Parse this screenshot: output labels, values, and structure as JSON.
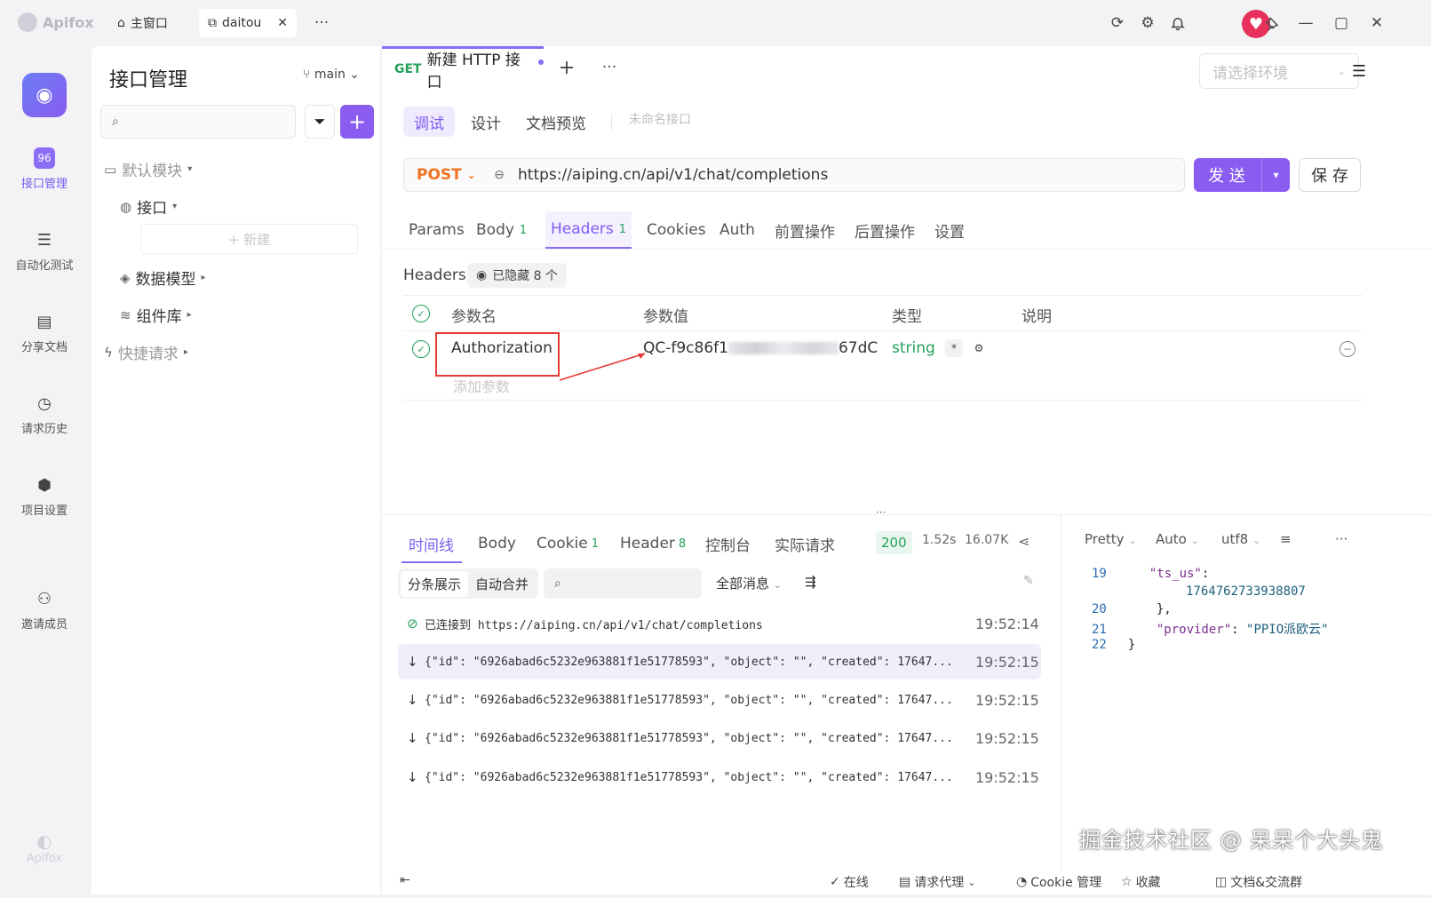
{
  "titlebar": {
    "app_name": "Apifox",
    "tabs": [
      {
        "label": "主窗口"
      },
      {
        "label": "daitou"
      }
    ],
    "more": "···"
  },
  "rail": {
    "items": [
      {
        "label": "接口管理",
        "icon": "api-icon"
      },
      {
        "label": "自动化测试",
        "icon": "stack-icon"
      },
      {
        "label": "分享文档",
        "icon": "book-icon"
      },
      {
        "label": "请求历史",
        "icon": "clock-icon"
      },
      {
        "label": "项目设置",
        "icon": "hexagon-icon"
      },
      {
        "label": "邀请成员",
        "icon": "user-plus-icon"
      }
    ],
    "footer": "Apifox"
  },
  "sidebar": {
    "title": "接口管理",
    "branch": "main",
    "tree": [
      {
        "label": "默认模块"
      },
      {
        "label": "接口"
      },
      {
        "label": "+ 新建"
      },
      {
        "label": "数据模型"
      },
      {
        "label": "组件库"
      },
      {
        "label": "快捷请求"
      }
    ]
  },
  "editor": {
    "doc_tab": {
      "method": "GET",
      "title": "新建 HTTP 接口"
    },
    "env_placeholder": "请选择环境",
    "sub_tabs": [
      {
        "label": "调试"
      },
      {
        "label": "设计"
      },
      {
        "label": "文档预览"
      }
    ],
    "unnamed": "未命名接口",
    "method": "POST",
    "url": "https://aiping.cn/api/v1/chat/completions",
    "send_label": "发 送",
    "save_label": "保 存",
    "req_tabs": [
      {
        "label": "Params",
        "count": ""
      },
      {
        "label": "Body",
        "count": "1"
      },
      {
        "label": "Headers",
        "count": "1"
      },
      {
        "label": "Cookies",
        "count": ""
      },
      {
        "label": "Auth",
        "count": ""
      },
      {
        "label": "前置操作",
        "count": ""
      },
      {
        "label": "后置操作",
        "count": ""
      },
      {
        "label": "设置",
        "count": ""
      }
    ],
    "headers_label": "Headers",
    "hidden_label": "已隐藏 8 个",
    "columns": [
      "参数名",
      "参数值",
      "类型",
      "说明"
    ],
    "row": {
      "name": "Authorization",
      "value_start": "QC-f9c86f1",
      "value_end": "67dC",
      "type": "string",
      "required": "*"
    },
    "add_param": "添加参数"
  },
  "response": {
    "tabs": [
      {
        "label": "时间线",
        "count": ""
      },
      {
        "label": "Body",
        "count": ""
      },
      {
        "label": "Cookie",
        "count": "1"
      },
      {
        "label": "Header",
        "count": "8"
      },
      {
        "label": "控制台",
        "count": ""
      },
      {
        "label": "实际请求",
        "count": ""
      }
    ],
    "status": "200",
    "time": "1.52s",
    "size": "16.07K",
    "seg": [
      "分条展示",
      "自动合并"
    ],
    "filter": "全部消息",
    "timeline": [
      {
        "msg": "已连接到 https://aiping.cn/api/v1/chat/completions",
        "time": "19:52:14"
      },
      {
        "msg": "{\"id\": \"6926abad6c5232e963881f1e51778593\", \"object\": \"\", \"created\": 17647...",
        "time": "19:52:15"
      },
      {
        "msg": "{\"id\": \"6926abad6c5232e963881f1e51778593\", \"object\": \"\", \"created\": 17647...",
        "time": "19:52:15"
      },
      {
        "msg": "{\"id\": \"6926abad6c5232e963881f1e51778593\", \"object\": \"\", \"created\": 17647...",
        "time": "19:52:15"
      },
      {
        "msg": "{\"id\": \"6926abad6c5232e963881f1e51778593\", \"object\": \"\", \"created\": 17647...",
        "time": "19:52:15"
      }
    ],
    "json_ctrl": [
      "Pretty",
      "Auto",
      "utf8"
    ],
    "code": [
      {
        "ln": "19",
        "key": "\"ts_us\"",
        "val": ""
      },
      {
        "ln": "",
        "key": "",
        "val": "1764762733938807"
      },
      {
        "ln": "20",
        "key": "",
        "val": "},"
      },
      {
        "ln": "21",
        "key": "\"provider\"",
        "val": "\"PPIO派欧云\""
      },
      {
        "ln": "22",
        "key": "",
        "val": "}"
      }
    ]
  },
  "statusbar": {
    "online": "在线",
    "proxy": "请求代理",
    "cookie": "Cookie 管理",
    "collect": "收藏",
    "community": "文档&交流群"
  },
  "watermark": "掘金技术社区 @ 呆呆个大头鬼",
  "colors": {
    "accent": "#8a5cf0",
    "get": "#23a05a",
    "post": "#f0731f",
    "annotation": "#e53935"
  }
}
